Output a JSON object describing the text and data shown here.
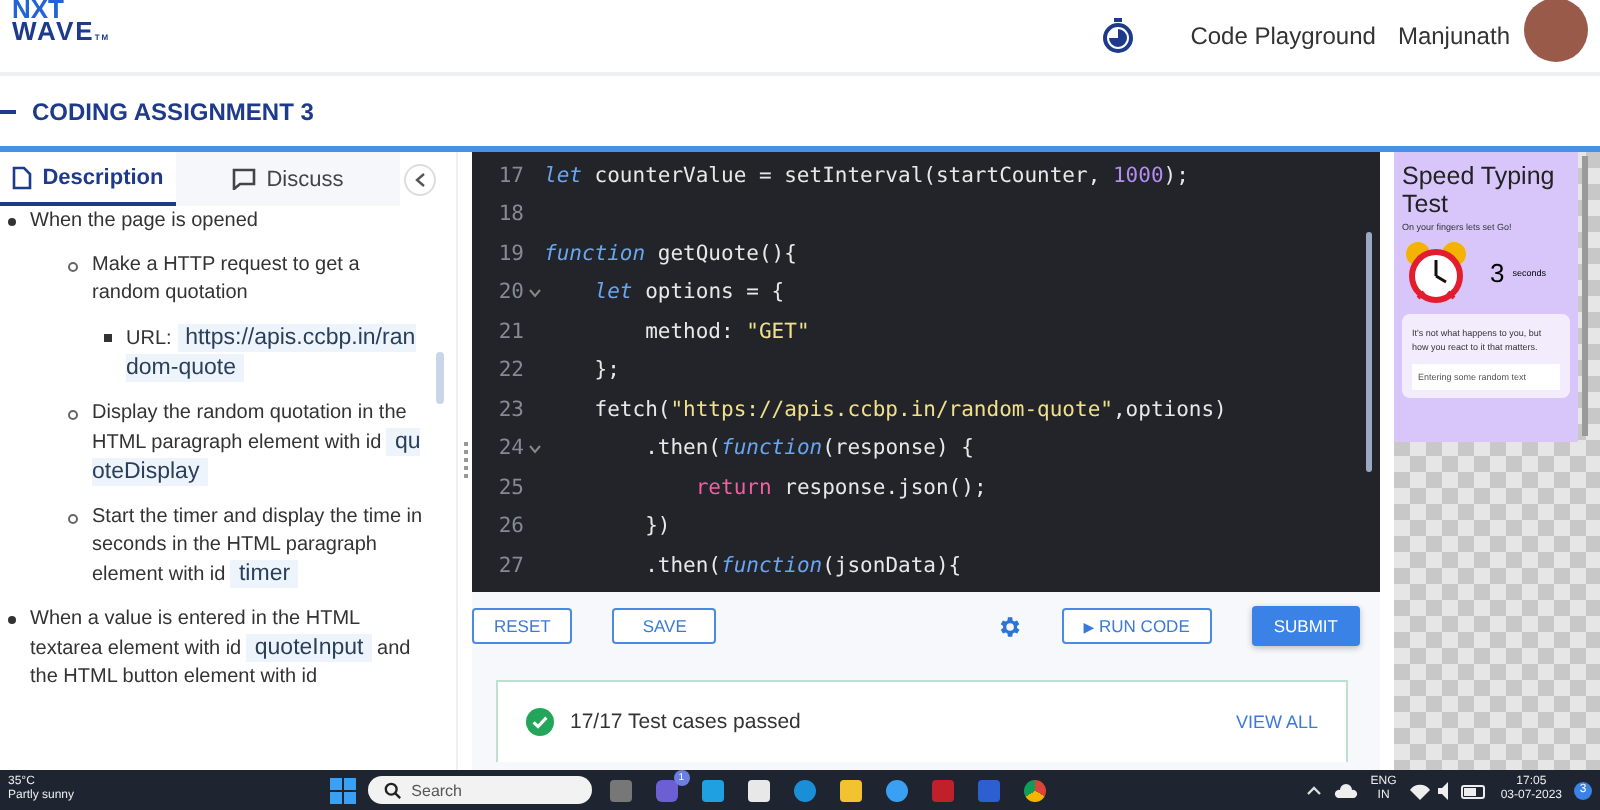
{
  "header": {
    "logo_top": "NXT",
    "logo_bottom": "WAVE",
    "logo_mark": "TM",
    "nav_link": "Code Playground",
    "user_name": "Manjunath"
  },
  "assignment": {
    "title": "CODING ASSIGNMENT 3"
  },
  "tabs": [
    {
      "label": "Description",
      "selected": true
    },
    {
      "label": "Discuss",
      "selected": false
    }
  ],
  "description": [
    {
      "parts": [
        {
          "text": "When the page is opened"
        }
      ],
      "children": [
        {
          "parts": [
            {
              "text": "Make a HTTP request to get a random quotation"
            }
          ],
          "children": [
            {
              "parts": [
                {
                  "text": "URL: "
                },
                {
                  "code": "https://apis.ccbp.in/random-quote"
                }
              ]
            }
          ]
        },
        {
          "parts": [
            {
              "text": "Display the random quotation in the HTML paragraph element with id "
            },
            {
              "code": "quoteDisplay"
            }
          ]
        },
        {
          "parts": [
            {
              "text": "Start the timer and display the time in seconds in the HTML paragraph element with id "
            },
            {
              "code": "timer"
            }
          ]
        }
      ]
    },
    {
      "parts": [
        {
          "text": "When a value is entered in the HTML textarea element with id "
        },
        {
          "code": "quoteInput"
        },
        {
          "text": " and the HTML button element with id"
        }
      ]
    }
  ],
  "code": [
    {
      "number": "17",
      "foldable": false,
      "tokens": [
        {
          "t": "let",
          "kind": "keyword"
        },
        {
          "t": " counterValue = setInterval(startCounter, ",
          "kind": "plain"
        },
        {
          "t": "1000",
          "kind": "number"
        },
        {
          "t": ");",
          "kind": "plain"
        }
      ]
    },
    {
      "number": "18",
      "foldable": false
    },
    {
      "number": "19",
      "foldable": false,
      "tokens": [
        {
          "t": "function",
          "kind": "keyword"
        },
        {
          "t": " getQuote(){",
          "kind": "plain"
        }
      ]
    },
    {
      "number": "20",
      "foldable": true,
      "tokens": [
        {
          "t": "    let",
          "kind": "keyword"
        },
        {
          "t": " options = {",
          "kind": "plain"
        }
      ]
    },
    {
      "number": "21",
      "foldable": false,
      "tokens": [
        {
          "t": "        method: ",
          "kind": "plain"
        },
        {
          "t": "\"GET\"",
          "kind": "string"
        }
      ]
    },
    {
      "number": "22",
      "foldable": false,
      "tokens": [
        {
          "t": "    };",
          "kind": "plain"
        }
      ]
    },
    {
      "number": "23",
      "foldable": false,
      "tokens": [
        {
          "t": "    fetch(",
          "kind": "plain"
        },
        {
          "t": "\"https://apis.ccbp.in/random-quote\"",
          "kind": "string"
        },
        {
          "t": ",options)",
          "kind": "plain"
        }
      ]
    },
    {
      "number": "24",
      "foldable": true,
      "tokens": [
        {
          "t": "        .then(",
          "kind": "plain"
        },
        {
          "t": "function",
          "kind": "keyword"
        },
        {
          "t": "(response) {",
          "kind": "plain"
        }
      ]
    },
    {
      "number": "25",
      "foldable": false,
      "tokens": [
        {
          "t": "            return",
          "kind": "control"
        },
        {
          "t": " response.json();",
          "kind": "plain"
        }
      ]
    },
    {
      "number": "26",
      "foldable": false,
      "tokens": [
        {
          "t": "        })",
          "kind": "plain"
        }
      ]
    },
    {
      "number": "27",
      "foldable": false,
      "tokens": [
        {
          "t": "        .then(",
          "kind": "plain"
        },
        {
          "t": "function",
          "kind": "keyword"
        },
        {
          "t": "(jsonData){",
          "kind": "plain"
        }
      ]
    }
  ],
  "toolbar": {
    "reset": "RESET",
    "save": "SAVE",
    "run": "RUN CODE",
    "run_icon": "▶",
    "submit": "SUBMIT"
  },
  "result": {
    "text": "17/17 Test cases passed",
    "link": "VIEW ALL",
    "passed": true
  },
  "preview": {
    "title": "Speed Typing Test",
    "subtitle": "On your fingers lets set Go!",
    "timer": "3",
    "timer_unit": "seconds",
    "quote": "It's not what happens to you, but how you react to it that matters.",
    "input_value": "Entering some random text"
  },
  "taskbar": {
    "temperature": "35°C",
    "weather": "Partly sunny",
    "search_placeholder": "Search",
    "chat_badge": "1",
    "language": "ENG",
    "region": "IN",
    "time": "17:05",
    "date": "03-07-2023",
    "notification_count": "3"
  }
}
